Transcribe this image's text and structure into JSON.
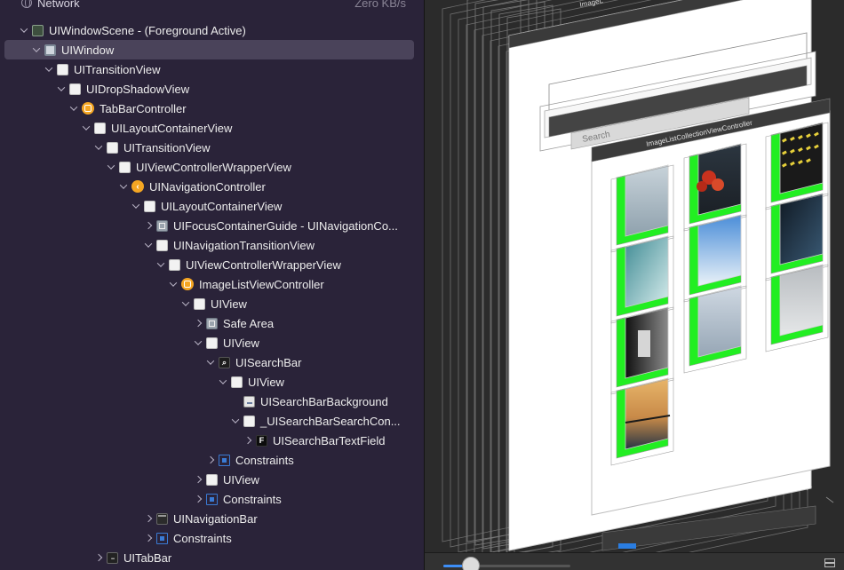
{
  "network": {
    "title": "Network",
    "speed": "Zero KB/s"
  },
  "tree": [
    {
      "label": "UIWindowScene - (Foreground Active)",
      "icon": "scene-icon",
      "depth": 0,
      "chevron": "open",
      "selected": false
    },
    {
      "label": "UIWindow",
      "icon": "window-icon",
      "depth": 1,
      "chevron": "open",
      "selected": true
    },
    {
      "label": "UITransitionView",
      "icon": "view-icon",
      "depth": 2,
      "chevron": "open",
      "selected": false
    },
    {
      "label": "UIDropShadowView",
      "icon": "view-icon",
      "depth": 3,
      "chevron": "open",
      "selected": false
    },
    {
      "label": "TabBarController",
      "icon": "view-controller-icon",
      "depth": 4,
      "chevron": "open",
      "selected": false
    },
    {
      "label": "UILayoutContainerView",
      "icon": "view-icon",
      "depth": 5,
      "chevron": "open",
      "selected": false
    },
    {
      "label": "UITransitionView",
      "icon": "view-icon",
      "depth": 6,
      "chevron": "open",
      "selected": false
    },
    {
      "label": "UIViewControllerWrapperView",
      "icon": "view-icon",
      "depth": 7,
      "chevron": "open",
      "selected": false
    },
    {
      "label": "UINavigationController",
      "icon": "navigation-controller-icon",
      "depth": 8,
      "chevron": "open",
      "selected": false
    },
    {
      "label": "UILayoutContainerView",
      "icon": "view-icon",
      "depth": 9,
      "chevron": "open",
      "selected": false
    },
    {
      "label": "UIFocusContainerGuide - UINavigationCo...",
      "icon": "focus-guide-icon",
      "depth": 10,
      "chevron": "closed",
      "selected": false
    },
    {
      "label": "UINavigationTransitionView",
      "icon": "view-icon",
      "depth": 10,
      "chevron": "open",
      "selected": false
    },
    {
      "label": "UIViewControllerWrapperView",
      "icon": "view-icon",
      "depth": 11,
      "chevron": "open",
      "selected": false
    },
    {
      "label": "ImageListViewController",
      "icon": "view-controller-icon",
      "depth": 12,
      "chevron": "open",
      "selected": false
    },
    {
      "label": "UIView",
      "icon": "view-icon",
      "depth": 13,
      "chevron": "open",
      "selected": false
    },
    {
      "label": "Safe Area",
      "icon": "focus-guide-icon",
      "depth": 14,
      "chevron": "closed",
      "selected": false
    },
    {
      "label": "UIView",
      "icon": "view-icon",
      "depth": 14,
      "chevron": "open",
      "selected": false
    },
    {
      "label": "UISearchBar",
      "icon": "search-bar-icon",
      "depth": 15,
      "chevron": "open",
      "selected": false
    },
    {
      "label": "UIView",
      "icon": "view-icon",
      "depth": 16,
      "chevron": "open",
      "selected": false
    },
    {
      "label": "UISearchBarBackground",
      "icon": "image-view-icon",
      "depth": 17,
      "chevron": "none",
      "selected": false
    },
    {
      "label": "_UISearchBarSearchCon...",
      "icon": "view-icon",
      "depth": 17,
      "chevron": "open",
      "selected": false
    },
    {
      "label": "UISearchBarTextField",
      "icon": "text-field-icon",
      "depth": 18,
      "chevron": "closed",
      "selected": false
    },
    {
      "label": "Constraints",
      "icon": "constraints-icon",
      "depth": 15,
      "chevron": "closed",
      "selected": false
    },
    {
      "label": "UIView",
      "icon": "view-icon",
      "depth": 14,
      "chevron": "closed",
      "selected": false
    },
    {
      "label": "Constraints",
      "icon": "constraints-icon",
      "depth": 14,
      "chevron": "closed",
      "selected": false
    },
    {
      "label": "UINavigationBar",
      "icon": "navigation-bar-icon",
      "depth": 10,
      "chevron": "closed",
      "selected": false
    },
    {
      "label": "Constraints",
      "icon": "constraints-icon",
      "depth": 10,
      "chevron": "closed",
      "selected": false
    },
    {
      "label": "UITabBar",
      "icon": "tab-bar-icon",
      "depth": 6,
      "chevron": "closed",
      "selected": false
    }
  ],
  "canvas": {
    "vc_label": "ImageListCollectionViewController",
    "top_label": "ImageL",
    "search_placeholder": "Search",
    "accent_green": "#22ee22",
    "photos": [
      "surfer",
      "balloons",
      "pattern",
      "ice",
      "snow-hikers",
      "tunnel",
      "aerial-waves",
      "houses",
      "fog",
      "dark-door",
      "sunset-surf"
    ]
  },
  "bottom_bar": {
    "zoom": 0.15
  }
}
